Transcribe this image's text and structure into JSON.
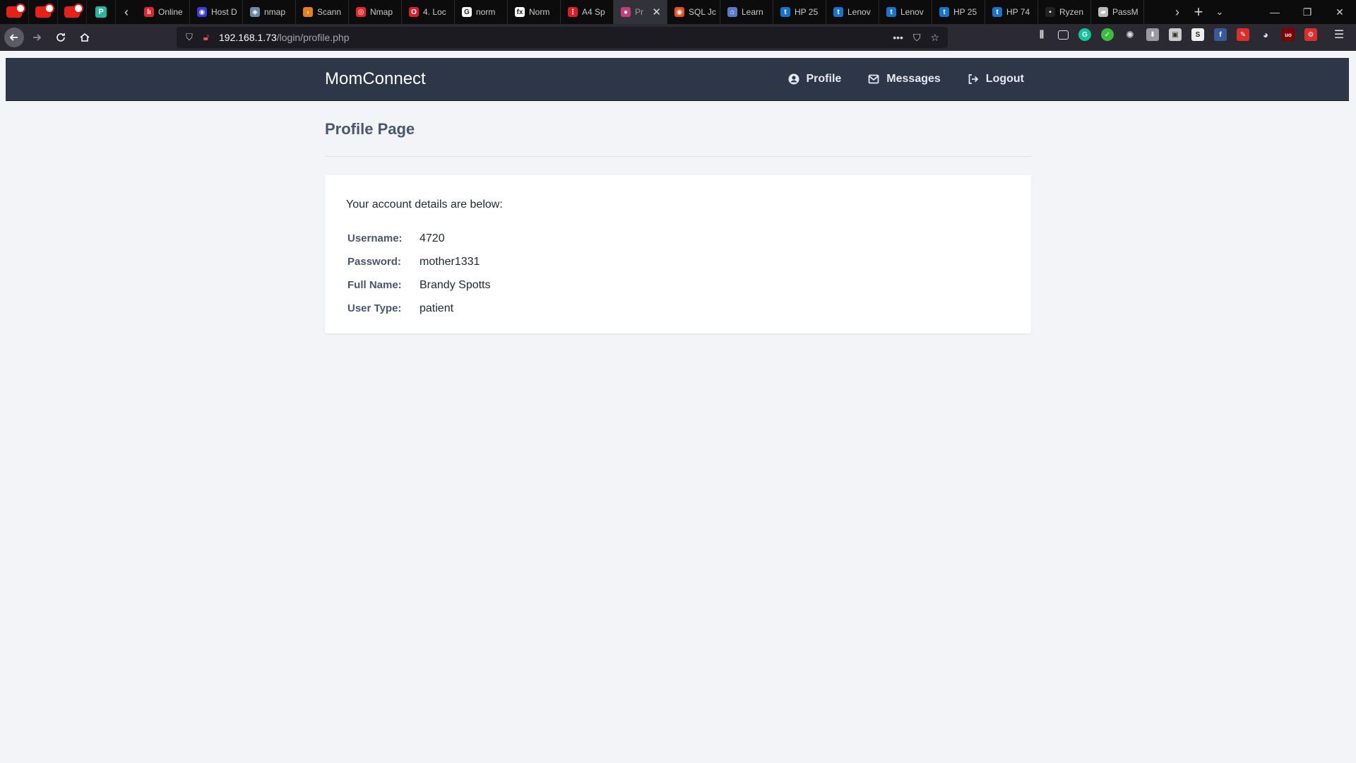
{
  "browser": {
    "tabs": [
      {
        "label": "Online",
        "fav_color": "#e0262e",
        "fav_glyph": "lı"
      },
      {
        "label": "Host D",
        "fav_color": "#3b3bd6",
        "fav_glyph": "◉"
      },
      {
        "label": "nmap",
        "fav_color": "#6d8aa8",
        "fav_glyph": "◈"
      },
      {
        "label": "Scann",
        "fav_color": "#e67e22",
        "fav_glyph": "›"
      },
      {
        "label": "Nmap",
        "fav_color": "#e02a2a",
        "fav_glyph": "◎"
      },
      {
        "label": "4. Loc",
        "fav_color": "#d6202a",
        "fav_glyph": "O"
      },
      {
        "label": "norm",
        "fav_color": "#ffffff",
        "fav_glyph": "G"
      },
      {
        "label": "Norm",
        "fav_color": "#ffffff",
        "fav_glyph": "fx"
      },
      {
        "label": "A4 Sp",
        "fav_color": "#d6202a",
        "fav_glyph": "⋮"
      },
      {
        "label": "Pr",
        "fav_color": "#c2407e",
        "fav_glyph": "●"
      },
      {
        "label": "SQL Jc",
        "fav_color": "#e8501e",
        "fav_glyph": "◉"
      },
      {
        "label": "Learn",
        "fav_color": "#5b7ac9",
        "fav_glyph": "⌂"
      },
      {
        "label": "HP 25",
        "fav_color": "#1a73c8",
        "fav_glyph": "t"
      },
      {
        "label": "Lenov",
        "fav_color": "#1a73c8",
        "fav_glyph": "t"
      },
      {
        "label": "Lenov",
        "fav_color": "#1a73c8",
        "fav_glyph": "t"
      },
      {
        "label": "HP 25",
        "fav_color": "#1a73c8",
        "fav_glyph": "t"
      },
      {
        "label": "HP 74",
        "fav_color": "#1a73c8",
        "fav_glyph": "t"
      },
      {
        "label": "Ryzen",
        "fav_color": "#222222",
        "fav_glyph": "▪"
      },
      {
        "label": "PassM",
        "fav_color": "#bbbbbb",
        "fav_glyph": "▰"
      }
    ],
    "active_tab_index": 9,
    "url_host": "192.168.1.73",
    "url_path": "/login/profile.php"
  },
  "site": {
    "brand": "MomConnect",
    "menu": {
      "profile": "Profile",
      "messages": "Messages",
      "logout": "Logout"
    }
  },
  "page": {
    "title": "Profile Page",
    "intro": "Your account details are below:",
    "details": {
      "username_label": "Username:",
      "username_value": "4720",
      "password_label": "Password:",
      "password_value": "mother1331",
      "fullname_label": "Full Name:",
      "fullname_value": "Brandy Spotts",
      "usertype_label": "User Type:",
      "usertype_value": "patient"
    }
  }
}
